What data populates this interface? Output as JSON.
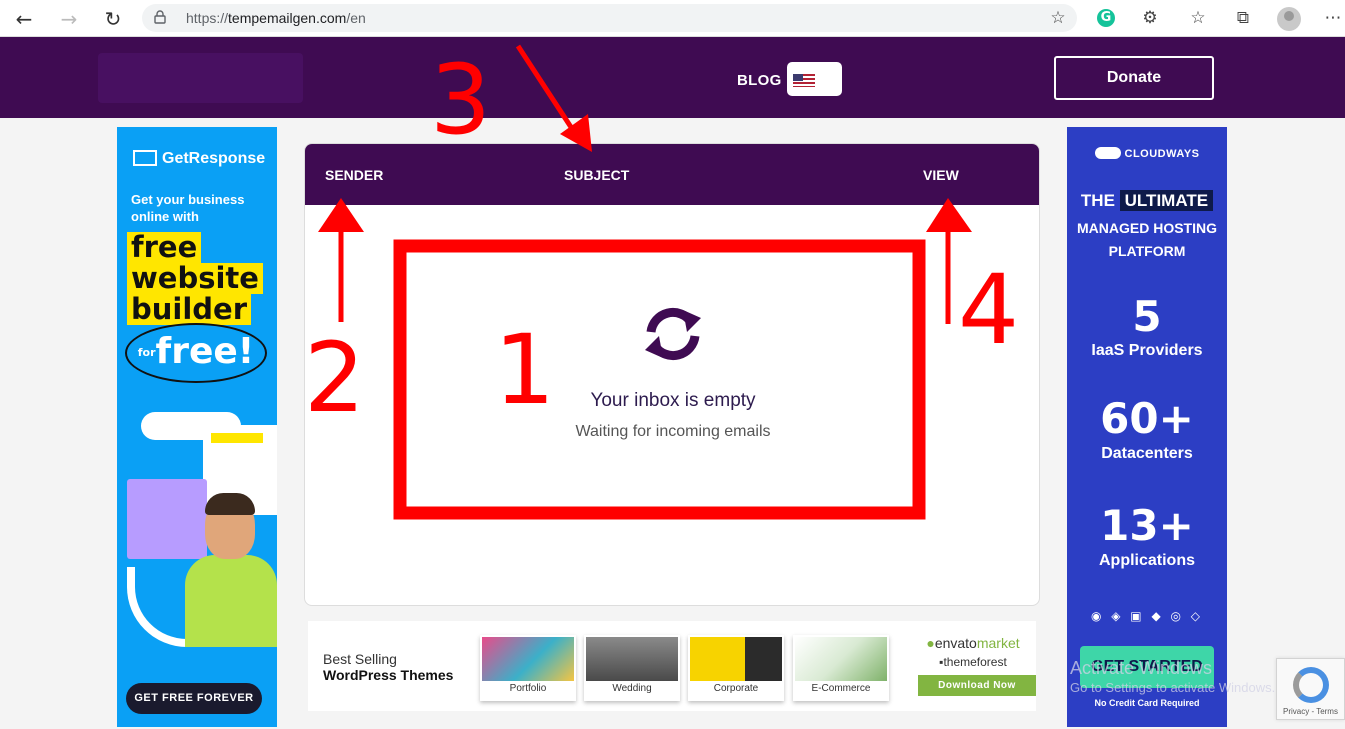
{
  "browser": {
    "url_scheme": "https://",
    "url_host": "tempemailgen.com",
    "url_path": "/en",
    "icons": [
      "back-icon",
      "forward-icon",
      "reload-icon",
      "lock-icon",
      "favorite-star-icon",
      "grammarly-icon",
      "extensions-icon",
      "favorites-icon",
      "collections-icon",
      "profile-icon",
      "more-icon"
    ]
  },
  "header": {
    "blog_label": "BLOG",
    "donate_label": "Donate",
    "brand_color": "#3f0b52"
  },
  "inbox": {
    "columns": {
      "sender": "SENDER",
      "subject": "SUBJECT",
      "view": "VIEW"
    },
    "empty_title": "Your inbox is empty",
    "empty_subtitle": "Waiting for incoming emails"
  },
  "ad_left": {
    "brand": "GetResponse",
    "tagline": "Get your business online with",
    "headline_lines": [
      "free",
      "website",
      "builder"
    ],
    "free_prefix": "for",
    "free_word": "free!",
    "cta": "GET FREE FOREVER"
  },
  "ad_right": {
    "brand": "CLOUDWAYS",
    "head_pre": "THE",
    "head_hl": "ULTIMATE",
    "sub_line1": "MANAGED HOSTING",
    "sub_line2": "PLATFORM",
    "stats": [
      {
        "value": "5",
        "label": "IaaS Providers"
      },
      {
        "value": "60+",
        "label": "Datacenters"
      },
      {
        "value": "13+",
        "label": "Applications"
      }
    ],
    "cta": "GET STARTED",
    "note": "No Credit Card Required"
  },
  "banner": {
    "title_line1": "Best Selling",
    "title_line2": "WordPress Themes",
    "thumbs": [
      {
        "label": "Portfolio"
      },
      {
        "label": "Wedding"
      },
      {
        "label": "Corporate"
      },
      {
        "label": "E-Commerce"
      }
    ],
    "envato_a": "envato",
    "envato_b": "market",
    "themeforest": "themeforest",
    "download": "Download Now"
  },
  "overlay": {
    "activate_line1": "Activate Windows",
    "activate_line2": "Go to Settings to activate Windows.",
    "recaptcha_terms": "Privacy - Terms"
  },
  "annotations": {
    "labels": [
      "1",
      "2",
      "3",
      "4"
    ],
    "color": "#ff0000"
  }
}
